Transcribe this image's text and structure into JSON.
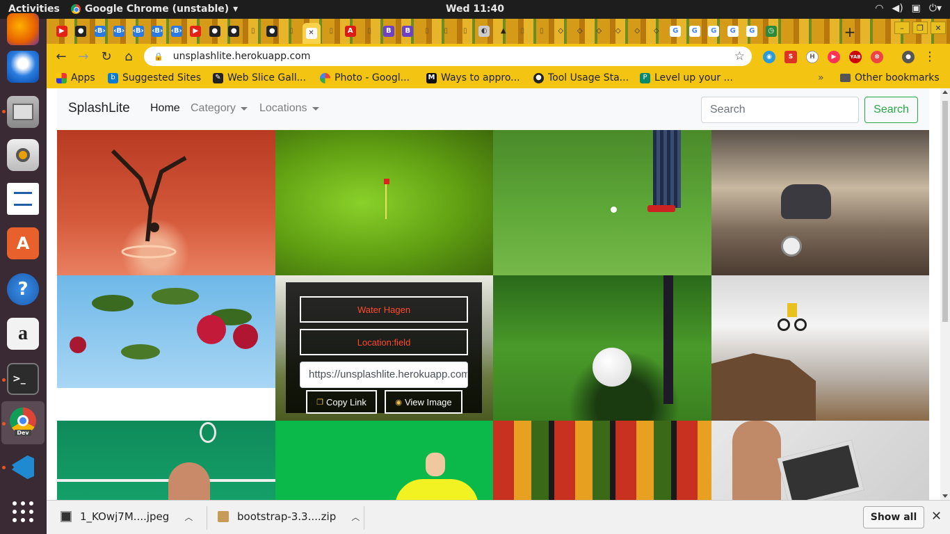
{
  "system_bar": {
    "activities": "Activities",
    "app_name": "Google Chrome (unstable)",
    "app_menu_arrow": "▾",
    "clock": "Wed 11:40",
    "tray": [
      "wifi-icon",
      "volume-icon",
      "clipboard-icon",
      "power-icon"
    ]
  },
  "dock": {
    "apps": [
      "firefox-icon",
      "thunderbird-icon",
      "files-icon",
      "rhythmbox-icon",
      "libreoffice-writer-icon",
      "software-center-icon",
      "help-icon",
      "amazon-icon",
      "terminal-icon",
      "chrome-dev-icon",
      "vscode-icon"
    ],
    "app_grid": "show-applications-icon",
    "chrome_dev_label": "Dev"
  },
  "browser": {
    "tab_favicons": [
      "youtube",
      "github",
      "bootstrap",
      "bootstrap",
      "bootstrap",
      "bootstrap",
      "bootstrap",
      "youtube",
      "github",
      "github",
      "document",
      "github",
      "document",
      "close",
      "document",
      "angular",
      "document",
      "bootstrap-b",
      "bootstrap-b",
      "document",
      "document",
      "document",
      "web",
      "triangle",
      "document",
      "document",
      "codepen",
      "codepen",
      "codepen",
      "codepen",
      "codepen",
      "codepen",
      "google",
      "google",
      "google",
      "google",
      "google",
      "clock"
    ],
    "new_tab": "+",
    "url": "unsplashlite.herokuapp.com",
    "bookmarks": [
      {
        "label": "Apps",
        "icon": "apps-grid-icon"
      },
      {
        "label": "Suggested Sites",
        "icon": "bing-icon"
      },
      {
        "label": "Web Slice Gall...",
        "icon": "web-slice-icon"
      },
      {
        "label": "Photo - Googl...",
        "icon": "google-photos-icon"
      },
      {
        "label": "Ways to appro...",
        "icon": "medium-icon"
      },
      {
        "label": "Tool Usage Sta...",
        "icon": "github-icon"
      },
      {
        "label": "Level up your ...",
        "icon": "page-icon"
      }
    ],
    "bookmarks_overflow": "»",
    "other_bookmarks": "Other bookmarks",
    "accent": "#f3c411"
  },
  "site": {
    "brand": "SplashLite",
    "nav": {
      "home": "Home",
      "category": "Category",
      "locations": "Locations"
    },
    "search_placeholder": "Search",
    "search_button": "Search",
    "overlay": {
      "title": "Water Hagen",
      "location": "Location:field",
      "link_value": "https://unsplashlite.herokuapp.com",
      "copy_link": "Copy Link",
      "view_image": "View Image"
    },
    "tiles": [
      {
        "subject": "dancer handstand on water splash"
      },
      {
        "subject": "golf green with red flag"
      },
      {
        "subject": "golfer putting on grass"
      },
      {
        "subject": "man leaping over clock"
      },
      {
        "subject": "red apples on branch"
      },
      {
        "subject": "trees in field (hovered)"
      },
      {
        "subject": "golf ball at hole"
      },
      {
        "subject": "mountain biker jumping"
      },
      {
        "subject": "tennis player serving"
      },
      {
        "subject": "illustrated man on green"
      },
      {
        "subject": "vegetable market stall"
      },
      {
        "subject": "man using tablet"
      }
    ]
  },
  "downloads": {
    "items": [
      {
        "name": "1_KOwj7M....jpeg"
      },
      {
        "name": "bootstrap-3.3....zip"
      }
    ],
    "show_all": "Show all"
  }
}
